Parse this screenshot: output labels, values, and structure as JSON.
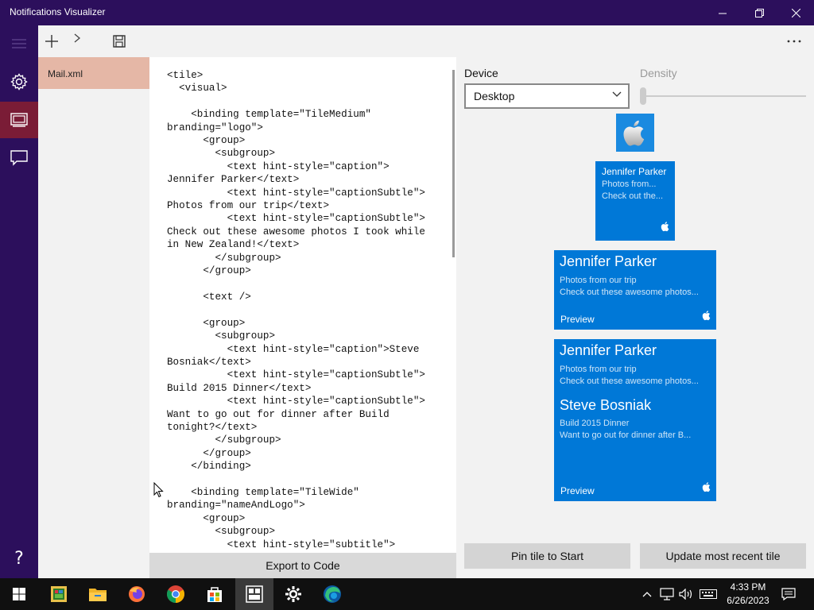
{
  "window": {
    "title": "Notifications Visualizer",
    "minimize": "—",
    "maximize": "❐",
    "close": "✕"
  },
  "files": [
    {
      "name": "Mail.xml",
      "selected": true
    }
  ],
  "editor": {
    "code": "<tile>\n  <visual>\n\n    <binding template=\"TileMedium\"\nbranding=\"logo\">\n      <group>\n        <subgroup>\n          <text hint-style=\"caption\">\nJennifer Parker</text>\n          <text hint-style=\"captionSubtle\">\nPhotos from our trip</text>\n          <text hint-style=\"captionSubtle\">\nCheck out these awesome photos I took while\nin New Zealand!</text>\n        </subgroup>\n      </group>\n\n      <text />\n\n      <group>\n        <subgroup>\n          <text hint-style=\"caption\">Steve\nBosniak</text>\n          <text hint-style=\"captionSubtle\">\nBuild 2015 Dinner</text>\n          <text hint-style=\"captionSubtle\">\nWant to go out for dinner after Build\ntonight?</text>\n        </subgroup>\n      </group>\n    </binding>\n\n    <binding template=\"TileWide\"\nbranding=\"nameAndLogo\">\n      <group>\n        <subgroup>\n          <text hint-style=\"subtitle\">",
    "export_label": "Export to Code"
  },
  "settings": {
    "device_label": "Device",
    "device_value": "Desktop",
    "density_label": "Density",
    "density_value": 0
  },
  "tiles": {
    "medium": {
      "title": "Jennifer Parker",
      "line1": "Photos from...",
      "line2": "Check out the..."
    },
    "wide": {
      "title": "Jennifer Parker",
      "line1": "Photos from our trip",
      "line2": "Check out these awesome photos...",
      "preview": "Preview"
    },
    "large": {
      "title1": "Jennifer Parker",
      "line1": "Photos from our trip",
      "line2": "Check out these awesome photos...",
      "title2": "Steve Bosniak",
      "line3": "Build 2015 Dinner",
      "line4": "Want to go out for dinner after B...",
      "preview": "Preview"
    }
  },
  "actions": {
    "pin": "Pin tile to Start",
    "update": "Update most recent tile"
  },
  "taskbar": {
    "time": "4:33 PM",
    "date": "6/26/2023"
  },
  "colors": {
    "accent_nav": "#2c0f5c",
    "nav_active": "#7a1c36",
    "file_selected": "#e5b7a6",
    "tile_blue": "#0078d7"
  }
}
